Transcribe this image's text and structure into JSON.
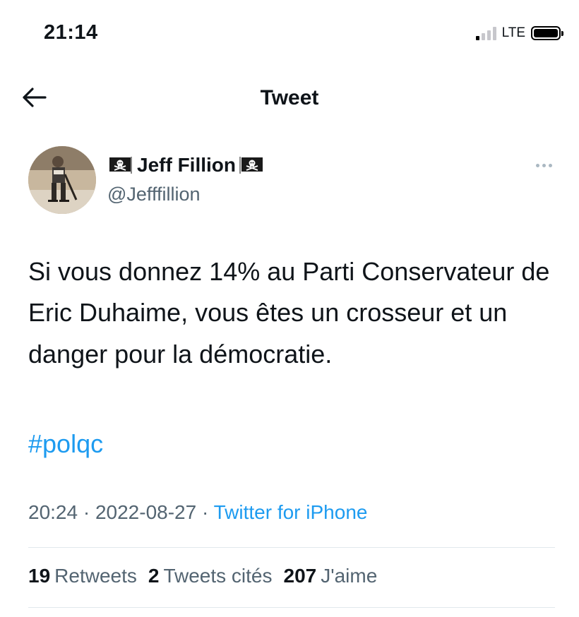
{
  "status_bar": {
    "time": "21:14",
    "network": "LTE"
  },
  "header": {
    "title": "Tweet",
    "back_icon": "arrow-left-icon"
  },
  "author": {
    "name": "Jeff Fillion",
    "handle": "@Jefffillion",
    "name_icon": "pirate-flag-icon",
    "more_icon": "more-horizontal-icon"
  },
  "tweet": {
    "text": "Si vous donnez 14% au Parti Conservateur de Eric Duhaime, vous êtes un crosseur et un danger pour la démocratie.",
    "hashtag": "#polqc",
    "time": "20:24",
    "date": "2022-08-27",
    "source": "Twitter for iPhone",
    "separator": "·"
  },
  "stats": {
    "retweets_count": "19",
    "retweets_label": "Retweets",
    "quotes_count": "2",
    "quotes_label": "Tweets cités",
    "likes_count": "207",
    "likes_label": "J'aime"
  },
  "colors": {
    "link": "#1d9bf0",
    "secondary_text": "#536471",
    "primary_text": "#0f1419",
    "divider": "#e1e8ed"
  }
}
